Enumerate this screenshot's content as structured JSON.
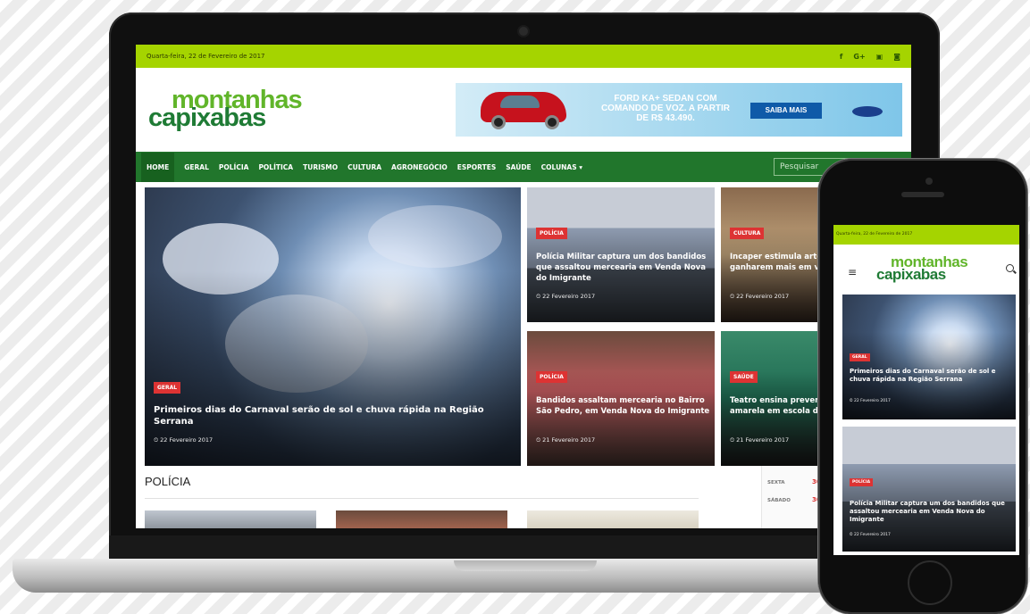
{
  "site": {
    "date": "Quarta-feira, 22 de Fevereiro de 2017",
    "logo_top": "montanhas",
    "logo_bottom": "capixabas",
    "social": [
      "f",
      "G+",
      "▣",
      "◙"
    ],
    "ad": {
      "text": "FORD KA+ SEDAN COM COMANDO DE VOZ. A PARTIR DE R$ 43.490.",
      "cta": "SAIBA MAIS"
    },
    "nav": [
      "HOME",
      "GERAL",
      "POLÍCIA",
      "POLÍTICA",
      "TURISMO",
      "CULTURA",
      "AGRONEGÓCIO",
      "ESPORTES",
      "SAÚDE",
      "COLUNAS ▾"
    ],
    "search_placeholder": "Pesquisar",
    "featured": {
      "category": "GERAL",
      "title": "Primeiros dias do Carnaval serão de sol e chuva rápida na Região Serrana",
      "date": "22 Fevereiro 2017"
    },
    "stories": [
      {
        "category": "POLÍCIA",
        "title": "Polícia Militar captura um dos bandidos que assaltou mercearia em Venda Nova do Imigrante",
        "date": "22 Fevereiro 2017"
      },
      {
        "category": "CULTURA",
        "title": "Incaper estimula artesãs de Chaves a ganharem mais em vendas em Vitória",
        "date": "22 Fevereiro 2017"
      },
      {
        "category": "POLÍCIA",
        "title": "Bandidos assaltam mercearia no Bairro São Pedro, em Venda Nova do Imigrante",
        "date": "21 Fevereiro 2017"
      },
      {
        "category": "SAÚDE",
        "title": "Teatro ensina prevenção da febre amarela em escola de Domingos Martins",
        "date": "21 Fevereiro 2017"
      }
    ],
    "section_title": "POLÍCIA",
    "sidebar_days": [
      {
        "day": "SEXTA",
        "num": "30"
      },
      {
        "day": "SÁBADO",
        "num": "30"
      }
    ]
  },
  "phone": {
    "date": "Quarta-feira, 22 de Fevereiro de 2017",
    "card1": {
      "category": "GERAL",
      "title": "Primeiros dias do Carnaval serão de sol e chuva rápida na Região Serrana",
      "date": "22 Fevereiro 2017"
    },
    "card2": {
      "category": "POLÍCIA",
      "title": "Polícia Militar captura um dos bandidos que assaltou mercearia em Venda Nova do Imigrante",
      "date": "22 Fevereiro 2017"
    }
  }
}
